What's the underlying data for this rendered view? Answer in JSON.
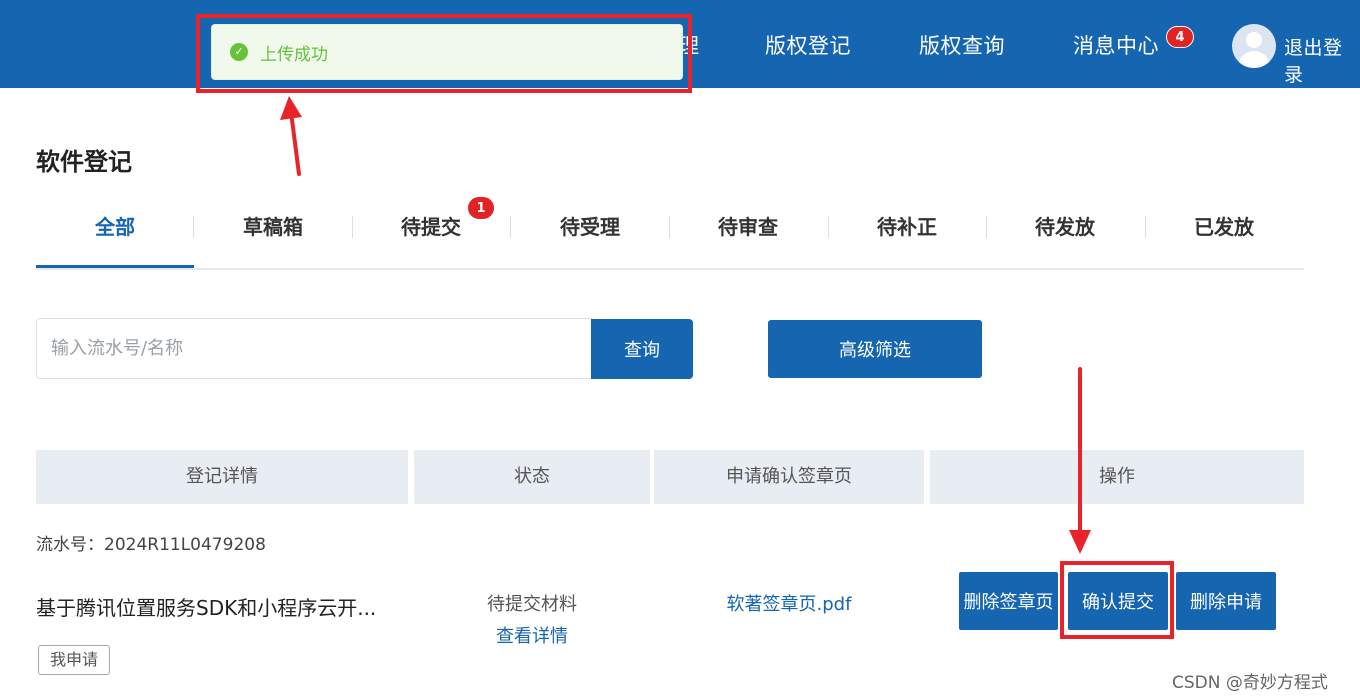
{
  "topbar": {
    "bg_color": "#1565b1",
    "nav": [
      {
        "label": "理"
      },
      {
        "label": "版权登记"
      },
      {
        "label": "版权查询"
      },
      {
        "label": "消息中心",
        "badge": "4"
      },
      {
        "label": "退出登录"
      }
    ]
  },
  "toast": {
    "text": "上传成功",
    "icon": "success-check-icon",
    "color": "#67c23a"
  },
  "page": {
    "title": "软件登记"
  },
  "tabs": [
    {
      "label": "全部",
      "active": true
    },
    {
      "label": "草稿箱"
    },
    {
      "label": "待提交",
      "badge": "1"
    },
    {
      "label": "待受理"
    },
    {
      "label": "待审查"
    },
    {
      "label": "待补正"
    },
    {
      "label": "待发放"
    },
    {
      "label": "已发放"
    }
  ],
  "search": {
    "placeholder": "输入流水号/名称",
    "query_button": "查询",
    "advanced_button": "高级筛选"
  },
  "table": {
    "headers": [
      "登记详情",
      "状态",
      "申请确认签章页",
      "操作"
    ],
    "rows": [
      {
        "serial": "流水号：2024R11L0479208",
        "title": "基于腾讯位置服务SDK和小程序云开...",
        "tag": "我申请",
        "status": "待提交材料",
        "status_link": "查看详情",
        "file": "软著签章页.pdf",
        "actions": [
          "删除签章页",
          "确认提交",
          "删除申请"
        ]
      }
    ]
  },
  "annotation_color": "#e8232b",
  "watermark": "CSDN @奇妙方程式"
}
